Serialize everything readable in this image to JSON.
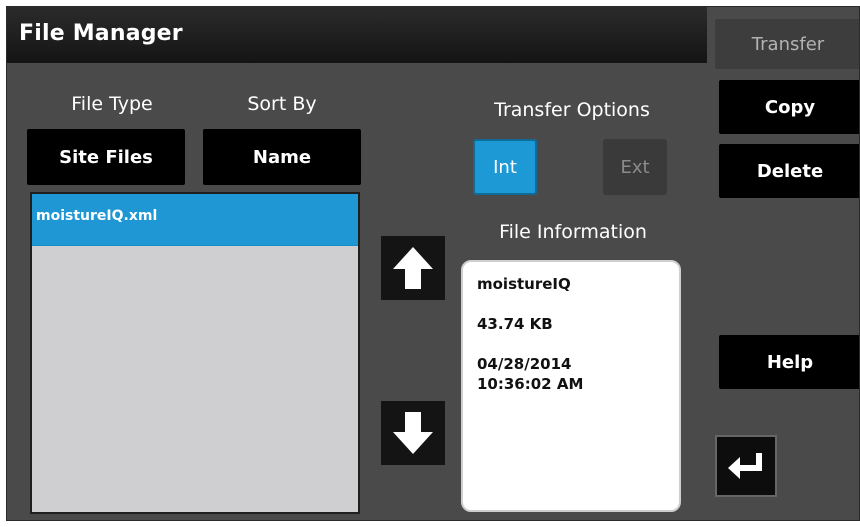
{
  "window": {
    "title": "File Manager"
  },
  "file_type": {
    "label": "File Type",
    "value": "Site Files"
  },
  "sort_by": {
    "label": "Sort By",
    "value": "Name"
  },
  "transfer_options": {
    "label": "Transfer Options",
    "int_label": "Int",
    "ext_label": "Ext",
    "selected": "Int",
    "active_color": "#1d9ad6"
  },
  "file_list": {
    "items": [
      "moistureIQ.xml"
    ],
    "selected_index": 0
  },
  "file_information": {
    "label": "File Information",
    "name": "moistureIQ",
    "size": "43.74 KB",
    "date": "04/28/2014",
    "time": "10:36:02 AM"
  },
  "sidebar": {
    "transfer_label": "Transfer",
    "copy_label": "Copy",
    "delete_label": "Delete",
    "help_label": "Help"
  },
  "icons": {
    "up": "arrow-up-icon",
    "down": "arrow-down-icon",
    "enter": "enter-return-icon"
  }
}
